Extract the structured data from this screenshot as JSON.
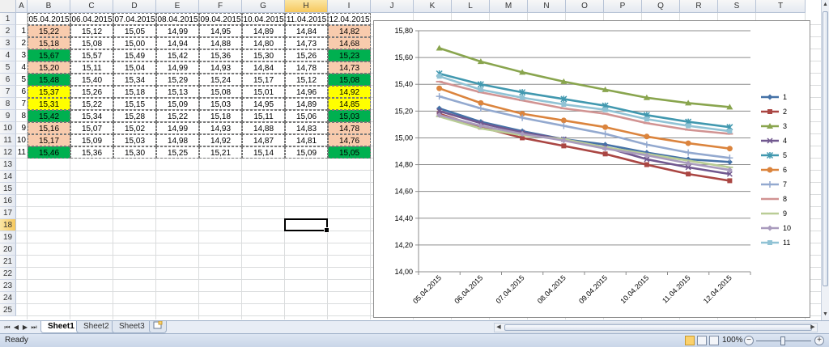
{
  "columns": [
    "A",
    "B",
    "C",
    "D",
    "E",
    "F",
    "G",
    "H",
    "I",
    "J",
    "K",
    "L",
    "M",
    "N",
    "O",
    "P",
    "Q",
    "R",
    "S",
    "T"
  ],
  "selected_column": "H",
  "row_numbers": [
    "1",
    "2",
    "3",
    "4",
    "5",
    "6",
    "7",
    "8",
    "9",
    "10",
    "11",
    "12",
    "13",
    "14",
    "15",
    "16",
    "17",
    "18",
    "19",
    "20",
    "21",
    "22",
    "23",
    "24",
    "25"
  ],
  "selected_row": "18",
  "table": {
    "headers": [
      "05.04.2015",
      "06.04.2015",
      "07.04.2015",
      "08.04.2015",
      "09.04.2015",
      "10.04.2015",
      "11.04.2015",
      "12.04.2015"
    ],
    "rows": [
      {
        "index": "1",
        "values": [
          "15,22",
          "15,12",
          "15,05",
          "14,99",
          "14,95",
          "14,89",
          "14,84",
          "14,82"
        ],
        "b_fill": "#f8cbad",
        "i_fill": "#f8cbad"
      },
      {
        "index": "2",
        "values": [
          "15,18",
          "15,08",
          "15,00",
          "14,94",
          "14,88",
          "14,80",
          "14,73",
          "14,68"
        ],
        "b_fill": "#f8cbad",
        "i_fill": "#f8cbad"
      },
      {
        "index": "3",
        "values": [
          "15,67",
          "15,57",
          "15,49",
          "15,42",
          "15,36",
          "15,30",
          "15,26",
          "15,23"
        ],
        "b_fill": "#00b050",
        "i_fill": "#00b050"
      },
      {
        "index": "4",
        "values": [
          "15,20",
          "15,11",
          "15,04",
          "14,99",
          "14,93",
          "14,84",
          "14,78",
          "14,73"
        ],
        "b_fill": "#f8cbad",
        "i_fill": "#f8cbad"
      },
      {
        "index": "5",
        "values": [
          "15,48",
          "15,40",
          "15,34",
          "15,29",
          "15,24",
          "15,17",
          "15,12",
          "15,08"
        ],
        "b_fill": "#00b050",
        "i_fill": "#00b050"
      },
      {
        "index": "6",
        "values": [
          "15,37",
          "15,26",
          "15,18",
          "15,13",
          "15,08",
          "15,01",
          "14,96",
          "14,92"
        ],
        "b_fill": "#ffff00",
        "i_fill": "#ffff00"
      },
      {
        "index": "7",
        "values": [
          "15,31",
          "15,22",
          "15,15",
          "15,09",
          "15,03",
          "14,95",
          "14,89",
          "14,85"
        ],
        "b_fill": "#ffff00",
        "i_fill": "#ffff00"
      },
      {
        "index": "8",
        "values": [
          "15,42",
          "15,34",
          "15,28",
          "15,22",
          "15,18",
          "15,11",
          "15,06",
          "15,03"
        ],
        "b_fill": "#00b050",
        "i_fill": "#00b050"
      },
      {
        "index": "9",
        "values": [
          "15,16",
          "15,07",
          "15,02",
          "14,99",
          "14,93",
          "14,88",
          "14,83",
          "14,78"
        ],
        "b_fill": "#f8cbad",
        "i_fill": "#f8cbad"
      },
      {
        "index": "10",
        "values": [
          "15,17",
          "15,09",
          "15,03",
          "14,98",
          "14,92",
          "14,87",
          "14,81",
          "14,76"
        ],
        "b_fill": "#f8cbad",
        "i_fill": "#f8cbad"
      },
      {
        "index": "11",
        "values": [
          "15,46",
          "15,36",
          "15,30",
          "15,25",
          "15,21",
          "15,14",
          "15,09",
          "15,05"
        ],
        "b_fill": "#00b050",
        "i_fill": "#00b050"
      }
    ]
  },
  "chart_data": {
    "type": "line",
    "title": "",
    "xlabel": "",
    "ylabel": "",
    "categories": [
      "05.04.2015",
      "06.04.2015",
      "07.04.2015",
      "08.04.2015",
      "09.04.2015",
      "10.04.2015",
      "11.04.2015",
      "12.04.2015"
    ],
    "ylim": [
      14.0,
      15.8
    ],
    "yticks": [
      "14,00",
      "14,20",
      "14,40",
      "14,60",
      "14,80",
      "15,00",
      "15,20",
      "15,40",
      "15,60",
      "15,80"
    ],
    "grid": true,
    "legend_position": "right",
    "series": [
      {
        "name": "1",
        "color": "#4572a7",
        "marker": "diamond",
        "values": [
          15.22,
          15.12,
          15.05,
          14.99,
          14.95,
          14.89,
          14.84,
          14.82
        ]
      },
      {
        "name": "2",
        "color": "#aa4643",
        "marker": "square",
        "values": [
          15.18,
          15.08,
          15.0,
          14.94,
          14.88,
          14.8,
          14.73,
          14.68
        ]
      },
      {
        "name": "3",
        "color": "#89a54e",
        "marker": "triangle",
        "values": [
          15.67,
          15.57,
          15.49,
          15.42,
          15.36,
          15.3,
          15.26,
          15.23
        ]
      },
      {
        "name": "4",
        "color": "#71588f",
        "marker": "x",
        "values": [
          15.2,
          15.11,
          15.04,
          14.99,
          14.93,
          14.84,
          14.78,
          14.73
        ]
      },
      {
        "name": "5",
        "color": "#4198af",
        "marker": "star",
        "values": [
          15.48,
          15.4,
          15.34,
          15.29,
          15.24,
          15.17,
          15.12,
          15.08
        ]
      },
      {
        "name": "6",
        "color": "#db843d",
        "marker": "circle",
        "values": [
          15.37,
          15.26,
          15.18,
          15.13,
          15.08,
          15.01,
          14.96,
          14.92
        ]
      },
      {
        "name": "7",
        "color": "#93a9cf",
        "marker": "plus",
        "values": [
          15.31,
          15.22,
          15.15,
          15.09,
          15.03,
          14.95,
          14.89,
          14.85
        ]
      },
      {
        "name": "8",
        "color": "#d19392",
        "marker": "dash",
        "values": [
          15.42,
          15.34,
          15.28,
          15.22,
          15.18,
          15.11,
          15.06,
          15.03
        ]
      },
      {
        "name": "9",
        "color": "#b9cd96",
        "marker": "dash",
        "values": [
          15.16,
          15.07,
          15.02,
          14.99,
          14.93,
          14.88,
          14.83,
          14.78
        ]
      },
      {
        "name": "10",
        "color": "#a99bbd",
        "marker": "diamond",
        "values": [
          15.17,
          15.09,
          15.03,
          14.98,
          14.92,
          14.87,
          14.81,
          14.76
        ]
      },
      {
        "name": "11",
        "color": "#91c3d5",
        "marker": "square",
        "values": [
          15.46,
          15.36,
          15.3,
          15.25,
          15.21,
          15.14,
          15.09,
          15.05
        ]
      }
    ]
  },
  "sheet_tabs": [
    "Sheet1",
    "Sheet2",
    "Sheet3"
  ],
  "active_sheet": "Sheet1",
  "status": {
    "ready": "Ready",
    "zoom": "100%",
    "zoom_minus": "−",
    "zoom_plus": "+"
  },
  "icons": {
    "new_sheet": "insert-sheet-icon",
    "nav_first": "⏮",
    "nav_prev": "◀",
    "nav_next": "▶",
    "nav_last": "⏭"
  }
}
